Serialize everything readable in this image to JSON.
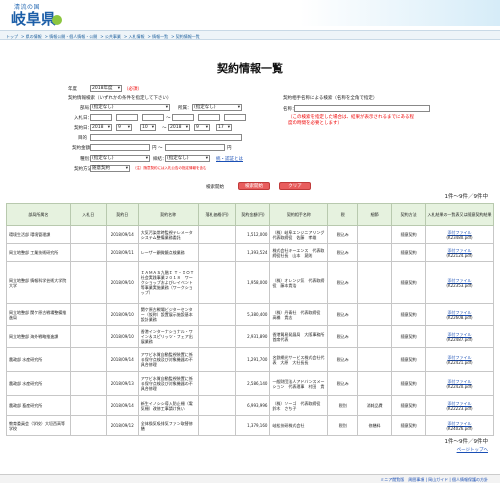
{
  "header": {
    "logo_small": "清流の国",
    "logo_big": "岐阜県"
  },
  "breadcrumb": [
    "トップ",
    "県の情報",
    "情報公開・個人情報・公開",
    "公共事業",
    "入札情報",
    "情報一覧",
    "契約情報一覧"
  ],
  "page_title": "契約情報一覧",
  "search": {
    "year_label": "年度",
    "year_value": "2018年度",
    "required": "（必須）",
    "section1_label": "契約情報検索（いずれかの条件を指定して下さい）",
    "section2_label": "契約相手名称による検索（名称を全角で指定）",
    "dept_label": "部局：",
    "dept_value": "(指定なし)",
    "office_label": "所属：",
    "office_value": "(指定なし)",
    "bid_label": "入札日：",
    "contract_label": "契約日：",
    "from_year": "2018",
    "from_month": "9",
    "from_day": "10",
    "to_year": "2018",
    "to_month": "9",
    "to_day": "17",
    "mokuteki_label": "目的",
    "amount_label": "契約金額",
    "yen": "円",
    "tilde": "〜",
    "kind_label": "種別：",
    "kind_value": "(指定なし)",
    "method_label": "締結：",
    "method_value": "(指定なし)",
    "method_link": "統・認証とは",
    "status_label": "契約方法",
    "status_value": "随意契約",
    "status_note": "（注）随意契約には入札公告の指定情報を含む",
    "name_label": "名称：",
    "name_note": "（この検索を指定した場合は、結果が表示されるまでにある程度の時間を必要とします）",
    "search_btn": "検索開始",
    "clear_btn": "クリア",
    "hint_label": "検索開始",
    "hint_clear": "クリア"
  },
  "count_text": "1件～9件／9件中",
  "columns": [
    "部局所属名",
    "入札日",
    "契約日",
    "契約名称",
    "落札価格(円)",
    "契約金額(円)",
    "契約相手名称",
    "税",
    "細節",
    "契約方法",
    "入札結果の一覧表又は随意契約結果"
  ],
  "rows": [
    {
      "dept": "環境生活部 環境管理課",
      "bid": "",
      "date": "2018/09/14",
      "name": "大気汚染常時監視テレメータシステム整備業務委託",
      "bid_price": "",
      "amount": "1,512,000",
      "partner": "（株）岐阜エンジニアリング　代表取締役　佐藤　孝雄",
      "tax": "税込み",
      "detail": "",
      "method": "随意契約",
      "file": "添付ファイル",
      "pdf": "(K23480.pdf)"
    },
    {
      "dept": "岡立地整部 工業技術研究所",
      "bid": "",
      "date": "2018/09/11",
      "name": "レーザー顕微鏡点検業務",
      "bid_price": "",
      "amount": "1,393,524",
      "partner": "株式会社キーエンス　代表取締役社長　山本　晃則",
      "tax": "税込み",
      "detail": "",
      "method": "随意契約",
      "file": "添付ファイル",
      "pdf": "(K22124.pdf)"
    },
    {
      "dept": "岡立地整部 情報科学芸術大学院大学",
      "bid": "",
      "date": "2018/09/10",
      "name": "ＩＡＭＡＳ九階Ｉ Ｔ・ＩＯＴ社会実践事業２０１８　ワークショップおよびレイベント等事業実施業務（ワークショップ）",
      "bid_price": "",
      "amount": "1,958,000",
      "partner": "（株）オレンジ気　代表取締役　藤本貴浩",
      "tax": "税込み",
      "detail": "",
      "method": "随意契約",
      "file": "添付ファイル",
      "pdf": "(K22353.pdf)"
    },
    {
      "dept": "岡立地整部 関ケ原古戦場整備推進局",
      "bid": "",
      "date": "2018/09/10",
      "name": "関ケ原古戦場ビジターセンター（仮称）設置展示施設基本設計業務",
      "bid_price": "",
      "amount": "5,380,400",
      "partner": "（株）丹青社　代表取締役　高橋　貴志",
      "tax": "税込み",
      "detail": "",
      "method": "随意契約",
      "file": "添付ファイル",
      "pdf": "(K22608.pdf)"
    },
    {
      "dept": "岡立地整部 海外戦略推進課",
      "bid": "",
      "date": "2018/09/10",
      "name": "香港インターナショナル・ワイン＆スピリッツ・フェア出展業務",
      "bid_price": "",
      "amount": "2,931,890",
      "partner": "香港貿易発展局　大阪事務所　首席代表",
      "tax": "税込み",
      "detail": "",
      "method": "随意契約",
      "file": "添付ファイル",
      "pdf": "(K22487.pdf)"
    },
    {
      "dept": "農政部 水産研究所",
      "bid": "",
      "date": "2018/09/14",
      "name": "アワビ水質自動監視装置に係る保守点検及び対象機器の不具合修理",
      "bid_price": "",
      "amount": "1,291,700",
      "partner": "名鉄網光サービス株式会社代表　大原　大社長長",
      "tax": "税込み",
      "detail": "",
      "method": "随意契約",
      "file": "添付ファイル",
      "pdf": "(K22421.pdf)"
    },
    {
      "dept": "農政部 水産研究所",
      "bid": "",
      "date": "2018/09/13",
      "name": "アワビ水質自動監視装置に係る保守点検及び対象機器の不具合修理",
      "bid_price": "",
      "amount": "2,586,140",
      "partner": "一般財団法人アドバンスメーション　代表理事　村田　貴",
      "tax": "税込み",
      "detail": "",
      "method": "随意契約",
      "file": "添付ファイル",
      "pdf": "(K22420.pdf)"
    },
    {
      "dept": "農政部 畜産研究所",
      "bid": "",
      "date": "2018/09/14",
      "name": "新生イノシシ導入防止柵（電気柵）改修工事請け負い",
      "bid_price": "",
      "amount": "6,993,996",
      "partner": "（株）ソーゴ　代表取締役　鈴木　さち子",
      "tax": "税別",
      "detail": "消耗品費",
      "method": "随意契約",
      "file": "添付ファイル",
      "pdf": "(K22223.pdf)"
    },
    {
      "dept": "教育委員会（学校）大垣西高等学校",
      "bid": "",
      "date": "2018/09/12",
      "name": "全体換気吸排気ファン取替修繕",
      "bid_price": "",
      "amount": "1,379,160",
      "partner": "岐松技研株式会社",
      "tax": "税別",
      "detail": "修繕料",
      "method": "随意契約",
      "file": "添付ファイル",
      "pdf": "(K24026.pdf)"
    }
  ],
  "pager_text": "ページトップへ",
  "footer_text": "ミニア閲覧版　周囲事項 | 岡山ガイド | 個人情報保護の方針",
  "colors": {
    "accent": "#1d5fa8",
    "header_row": "#e6f2df",
    "button": "#e85d5d"
  }
}
